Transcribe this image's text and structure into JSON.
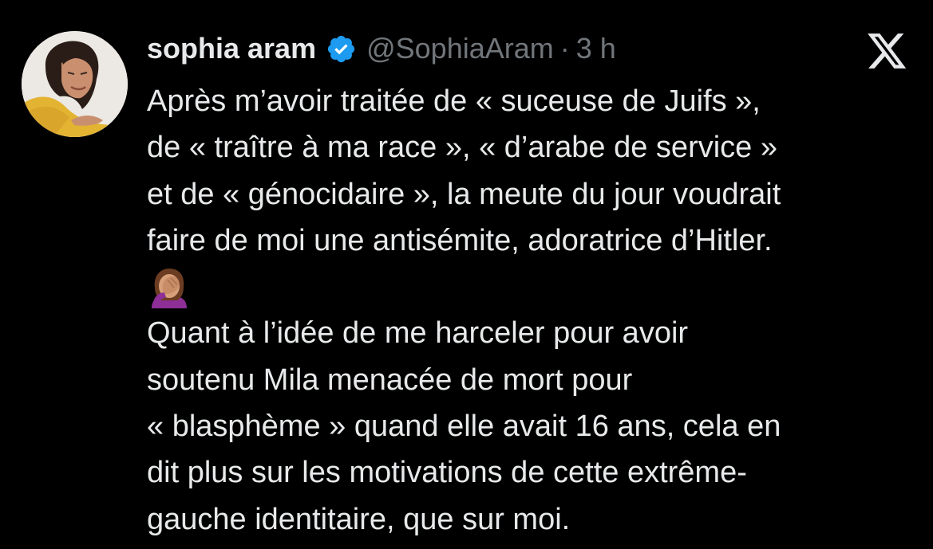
{
  "user": {
    "display_name": "sophia aram",
    "handle": "@SophiaAram",
    "separator": "·",
    "time": "3 h",
    "verified_icon": "verified-badge-icon",
    "avatar": "profile-photo"
  },
  "platform_icon": "x-logo-icon",
  "tweet": {
    "lines": [
      "Après m’avoir traitée de « suceuse de Juifs »,",
      "de « traître à ma race », « d’arabe de service »",
      "et de « génocidaire », la meute du jour voudrait",
      "faire de moi une antisémite, adoratrice d’Hitler."
    ],
    "emoji": "face-palm-emoji",
    "lines2": [
      "Quant à l’idée de me harceler pour avoir",
      "soutenu Mila menacée de mort pour",
      "« blasphème » quand elle avait 16 ans, cela en",
      "dit plus sur les motivations de cette extrême-",
      "gauche identitaire, que sur moi."
    ]
  },
  "colors": {
    "background": "#000000",
    "text": "#e7e9ea",
    "secondary": "#71767b",
    "verified": "#1d9bf0"
  }
}
